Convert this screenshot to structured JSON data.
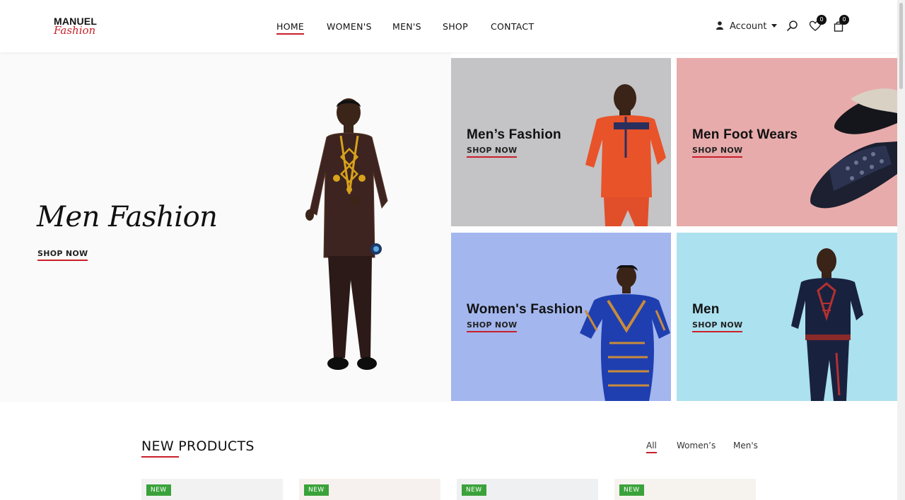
{
  "colors": {
    "accent": "#c8202a",
    "badge_green": "#3aa23a"
  },
  "logo": {
    "line1": "MANUEL",
    "line2": "Fashion"
  },
  "nav": {
    "items": [
      "HOME",
      "WOMEN'S",
      "MEN'S",
      "SHOP",
      "CONTACT"
    ],
    "active": "HOME"
  },
  "header": {
    "account_label": "Account",
    "wishlist_count": "0",
    "cart_count": "0",
    "icons": [
      "user-icon",
      "search-icon",
      "heart-icon",
      "bag-icon"
    ]
  },
  "hero": {
    "title": "Men Fashion",
    "cta": "SHOP NOW"
  },
  "tiles": [
    {
      "title": "Men’s Fashion",
      "cta": "SHOP NOW",
      "bg": "#c4c3c5"
    },
    {
      "title": "Men Foot Wears",
      "cta": "SHOP NOW",
      "bg": "#e8abab"
    },
    {
      "title": "Women's Fashion",
      "cta": "SHOP NOW",
      "bg": "#a3b6ee"
    },
    {
      "title": "Men",
      "cta": "SHOP NOW",
      "bg": "#ace1ef"
    }
  ],
  "new_products": {
    "title": "NEW PRODUCTS",
    "filters": [
      "All",
      "Women’s",
      "Men's"
    ],
    "active_filter": "All",
    "badges": [
      "NEW",
      "NEW",
      "NEW",
      "NEW"
    ]
  }
}
